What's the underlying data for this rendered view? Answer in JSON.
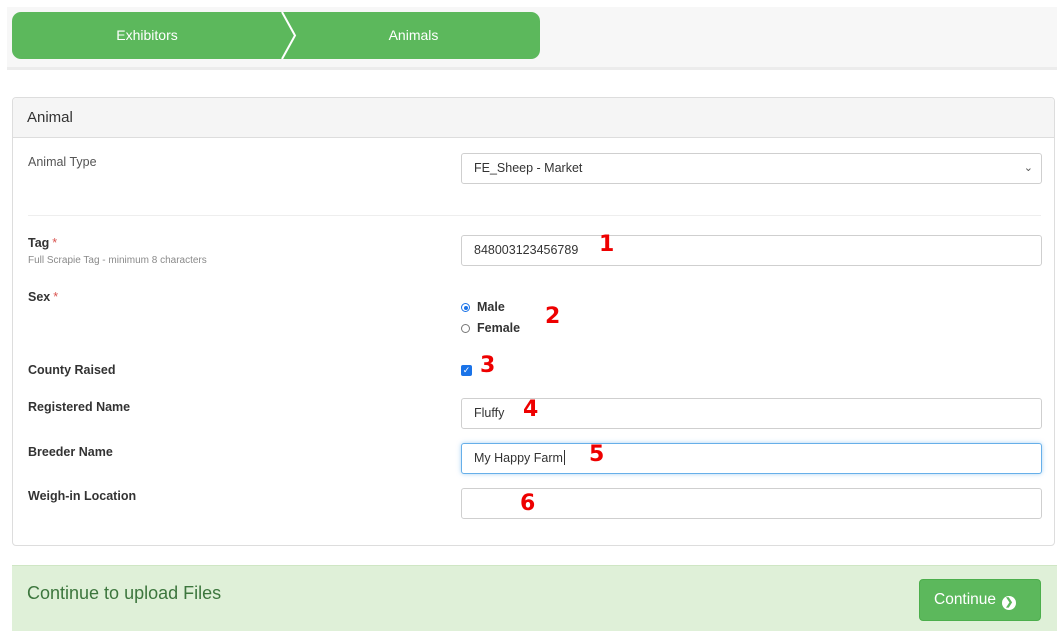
{
  "steps": {
    "step1": "Exhibitors",
    "step2": "Animals"
  },
  "panel": {
    "title": "Animal"
  },
  "form": {
    "animal_type": {
      "label": "Animal Type",
      "value": "FE_Sheep - Market"
    },
    "tag": {
      "label": "Tag",
      "required_mark": "*",
      "help": "Full Scrapie Tag - minimum 8 characters",
      "value": "848003123456789"
    },
    "sex": {
      "label": "Sex",
      "required_mark": "*",
      "options": [
        "Male",
        "Female"
      ],
      "selected": "Male"
    },
    "county_raised": {
      "label": "County Raised",
      "checked": true
    },
    "registered_name": {
      "label": "Registered Name",
      "value": "Fluffy"
    },
    "breeder_name": {
      "label": "Breeder Name",
      "value": "My Happy Farm"
    },
    "weigh_in_location": {
      "label": "Weigh-in Location",
      "value": ""
    }
  },
  "annotations": [
    "1",
    "2",
    "3",
    "4",
    "5",
    "6"
  ],
  "continue_bar": {
    "text": "Continue to upload Files",
    "button_label": "Continue"
  },
  "colors": {
    "step_green": "#5cb85c",
    "continue_bg": "#dff0d8",
    "continue_text": "#3c763d",
    "annotation_red": "#ee0000",
    "accent_blue": "#1a73e8"
  },
  "icons": {
    "select_caret": "chevron-down-icon",
    "continue_arrow": "arrow-circle-right-icon",
    "step_separator": "chevron-separator-icon"
  }
}
